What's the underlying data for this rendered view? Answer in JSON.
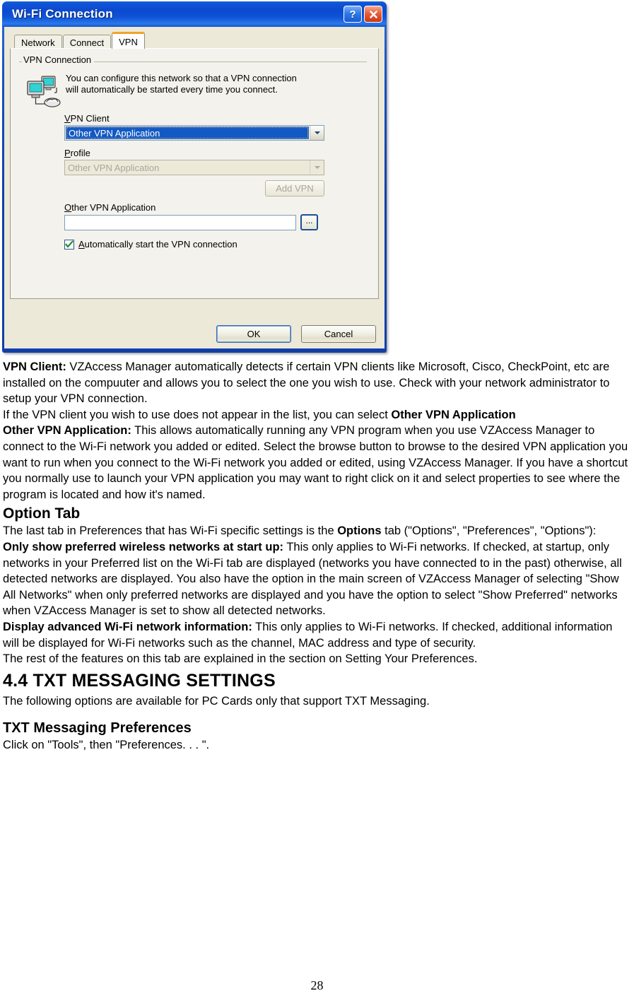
{
  "dialog": {
    "title": "Wi-Fi Connection",
    "caption_buttons": [
      {
        "name": "help",
        "glyph": "?"
      },
      {
        "name": "close",
        "glyph": "✕"
      }
    ],
    "tabs": [
      {
        "label": "Network",
        "active": false
      },
      {
        "label": "Connect",
        "active": false
      },
      {
        "label": "VPN",
        "active": true
      }
    ],
    "group_title": "VPN Connection",
    "intro_line1": "You can configure this network so that a VPN connection",
    "intro_line2": "will automatically be started every time you connect.",
    "vpn_client_label": "VPN Client",
    "vpn_client_value": "Other VPN Application",
    "profile_label": "Profile",
    "profile_value": "Other VPN Application",
    "add_vpn_label": "Add VPN",
    "other_app_label": "Other VPN Application",
    "other_app_value": "",
    "browse_label": "...",
    "autostart_label": "Automatically start the VPN connection",
    "ok_label": "OK",
    "cancel_label": "Cancel",
    "colors": {
      "titlebar_blue": "#0c49cf",
      "dialog_face": "#ece9d8",
      "tab_active_accent": "#f0a32a",
      "selection_blue": "#1259c4",
      "close_red": "#c93718",
      "check_green": "#1f8a2a"
    }
  },
  "doc": {
    "para_vpn_client_bold": "VPN Client:",
    "para_vpn_client": " VZAccess Manager automatically detects if certain VPN clients like Microsoft, Cisco, CheckPoint, etc are installed on the compuuter and allows you to select the one you wish to use. Check with your network administrator to setup your VPN connection.",
    "para_if_client_pre": "If the VPN client you wish to use does not appear in the list, you can select ",
    "para_if_client_bold": "Other VPN Application",
    "para_other_app_bold": "Other VPN Application:",
    "para_other_app": " This allows automatically running any VPN program when you use VZAccess Manager to connect to the Wi-Fi network you added or edited. Select the browse button to browse to the desired VPN application you want to run when you connect to the Wi-Fi network you added or edited, using VZAccess Manager. If you have a shortcut you normally use to launch your VPN application you may want to right click on it and select properties to see where the program is located and how it's named.",
    "heading_option_tab": "Option Tab",
    "para_last_tab_pre": "The last tab in Preferences that has Wi-Fi specific settings is the ",
    "para_last_tab_bold": "Options",
    "para_last_tab_post": " tab (\"Options\", \"Preferences\", \"Options\"):",
    "para_only_show_bold": "Only show preferred wireless networks at start up:",
    "para_only_show": " This only applies to Wi-Fi networks. If checked, at startup, only networks in your Preferred list on the Wi-Fi tab are displayed (networks you have connected to in the past) otherwise, all detected networks are displayed. You also have the option in the main screen of VZAccess Manager of selecting \"Show All Networks\" when only preferred networks are displayed and you have the option to select \"Show Preferred\" networks when VZAccess Manager is set to show all detected networks.",
    "para_display_adv_bold": "Display advanced Wi-Fi network information:",
    "para_display_adv": " This only applies to Wi-Fi networks. If checked, additional information will be displayed for Wi-Fi networks such as the channel, MAC address and type of security.",
    "para_rest": "The rest of the features on this tab are explained in the section on Setting Your Preferences.",
    "heading_section": "4.4 TXT MESSAGING SETTINGS",
    "para_following": "The following options are available for PC Cards only that support TXT Messaging.",
    "heading_txt_prefs": "TXT Messaging Preferences",
    "para_click_tools": "Click on \"Tools\", then \"Preferences. . . \".",
    "page_number": "28"
  }
}
